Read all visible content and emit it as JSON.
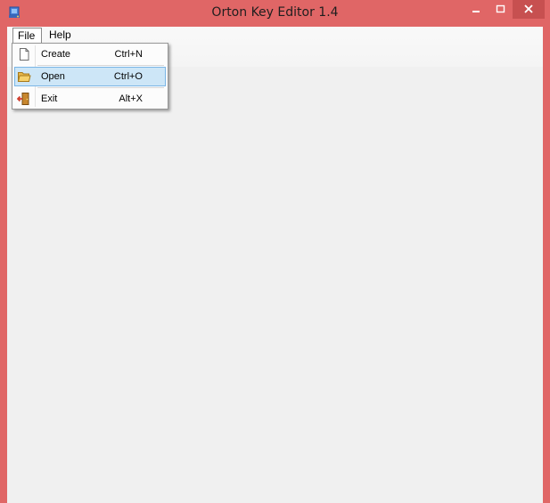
{
  "window": {
    "title": "Orton Key Editor 1.4",
    "frame_color": "#e06666",
    "close_color": "#c75050"
  },
  "menubar": {
    "items": [
      {
        "label": "File",
        "open": true
      },
      {
        "label": "Help",
        "open": false
      }
    ]
  },
  "file_menu": {
    "items": [
      {
        "label": "Create",
        "shortcut": "Ctrl+N",
        "icon": "new-document-icon",
        "highlighted": false
      },
      {
        "label": "Open",
        "shortcut": "Ctrl+O",
        "icon": "open-folder-icon",
        "highlighted": true
      },
      {
        "label": "Exit",
        "shortcut": "Alt+X",
        "icon": "exit-door-icon",
        "highlighted": false
      }
    ]
  }
}
